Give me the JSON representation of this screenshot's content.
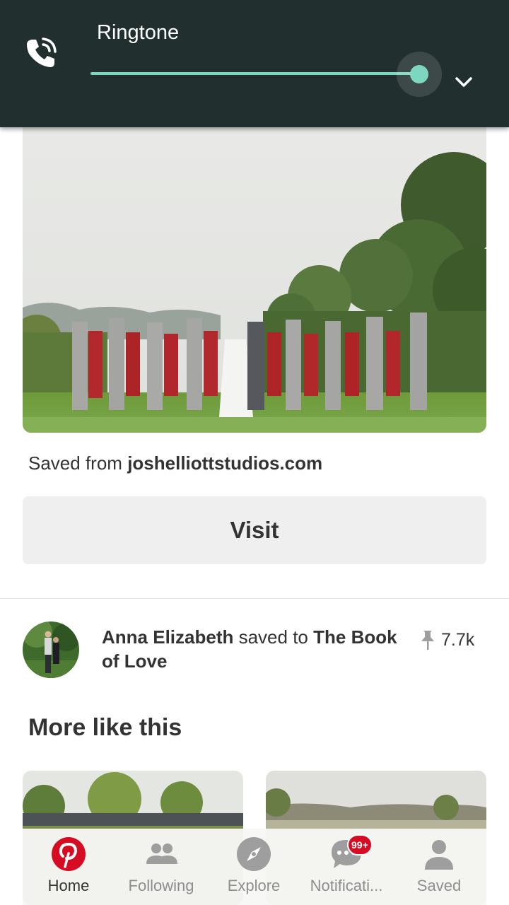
{
  "volume_panel": {
    "label": "Ringtone",
    "level": 0.93,
    "icon": "phone-ringing-icon",
    "expand_icon": "chevron-down-icon",
    "accent": "#7dd7c0",
    "background": "#21302f"
  },
  "pin": {
    "image_icon": "wedding-party-photo",
    "saved_from_prefix": "Saved from",
    "source_domain": "joshelliottstudios.com",
    "visit_label": "Visit"
  },
  "attribution": {
    "user": "Anna Elizabeth",
    "connector": "saved to",
    "board": "The Book of Love",
    "pin_count": "7.7k",
    "pin_icon": "pushpin-icon"
  },
  "more_like_this": {
    "title": "More like this"
  },
  "bottom_nav": {
    "items": [
      {
        "label": "Home",
        "icon": "pinterest-logo-icon",
        "active": true
      },
      {
        "label": "Following",
        "icon": "people-icon",
        "active": false
      },
      {
        "label": "Explore",
        "icon": "compass-icon",
        "active": false
      },
      {
        "label": "Notificati...",
        "icon": "chat-bubble-icon",
        "badge": "99+",
        "active": false
      },
      {
        "label": "Saved",
        "icon": "profile-icon",
        "active": false
      }
    ],
    "brand_color": "#d50c22",
    "inactive_color": "#9e9e9e"
  }
}
